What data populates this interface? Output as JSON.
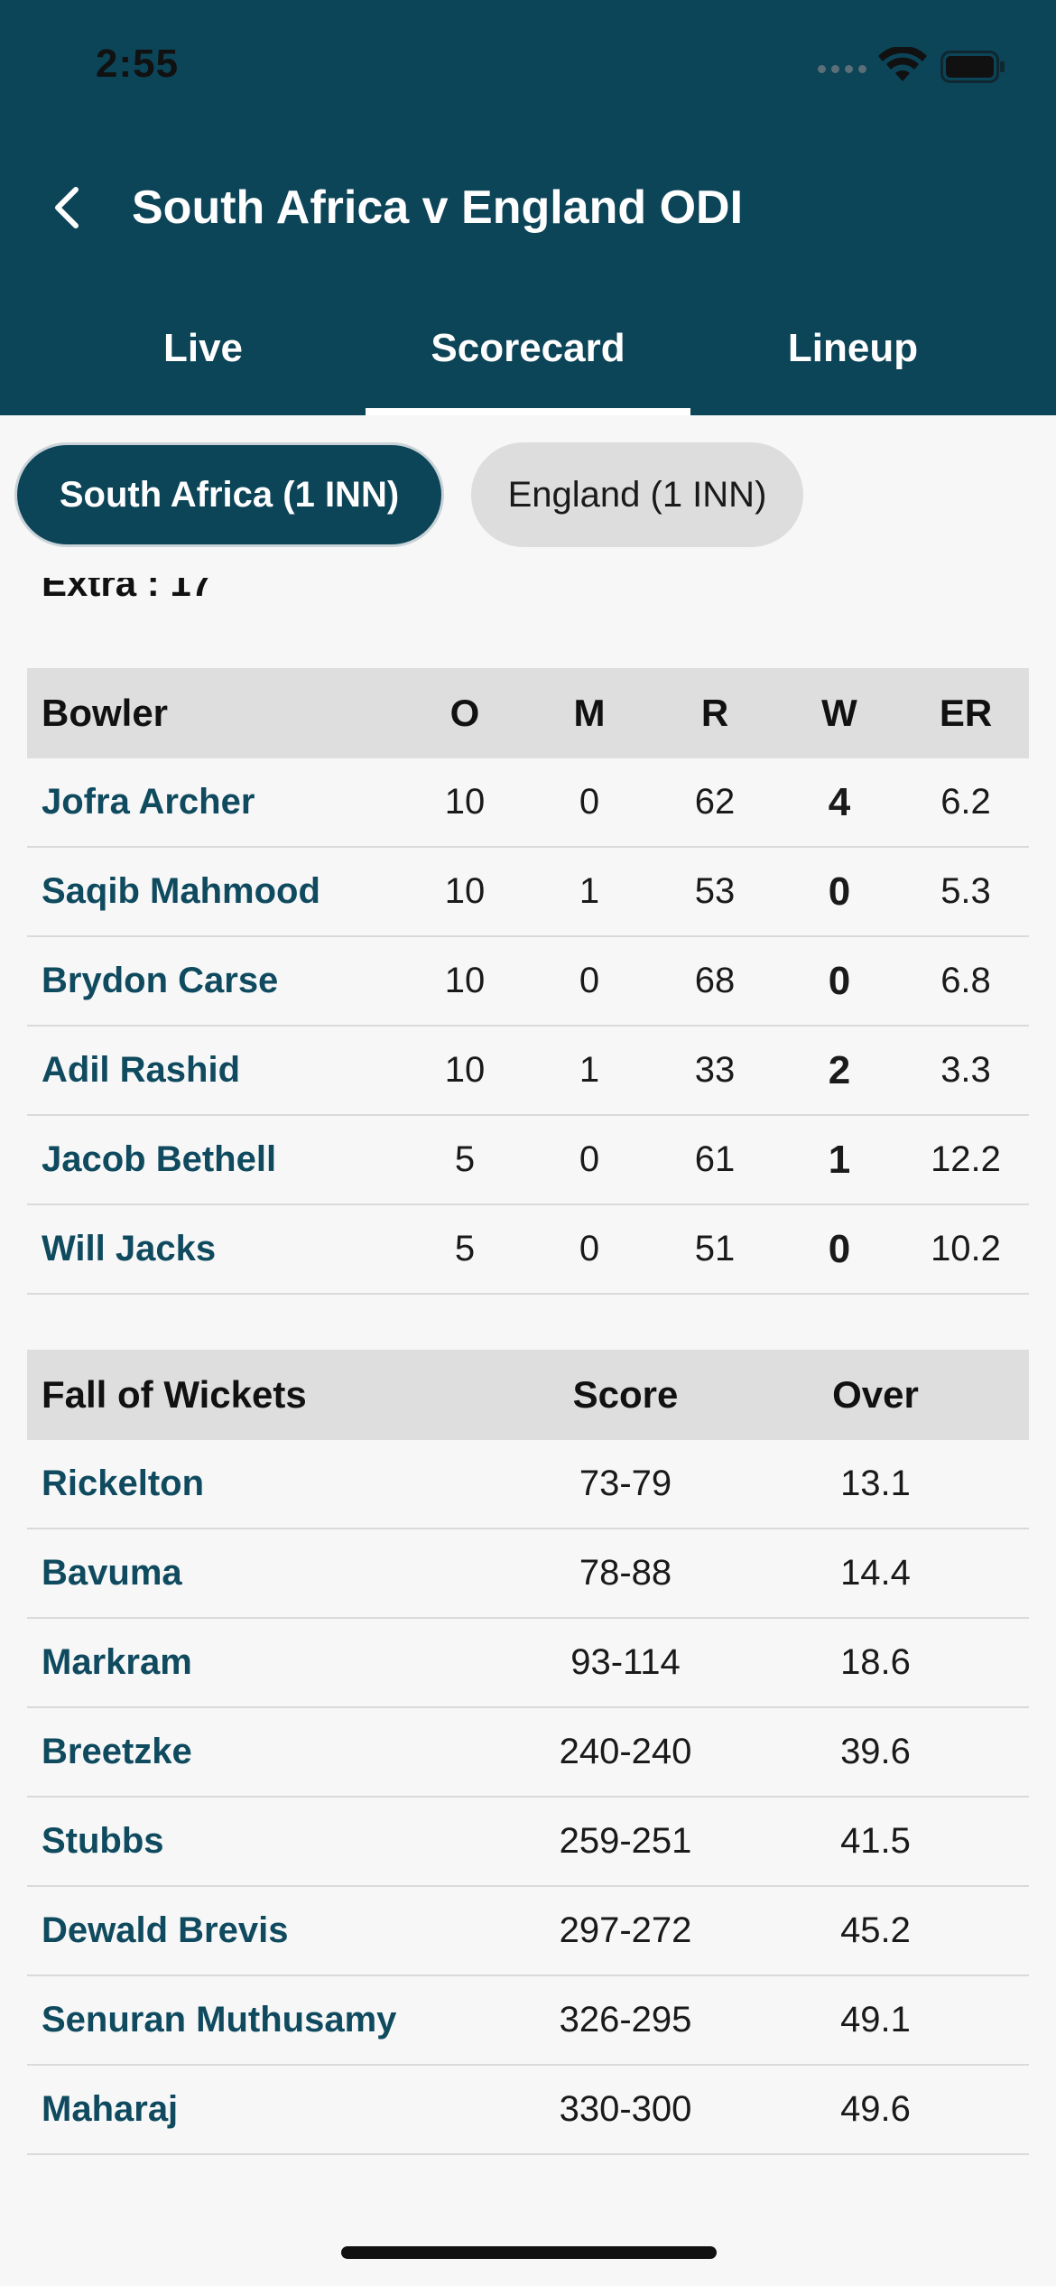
{
  "status_bar": {
    "time": "2:55"
  },
  "header": {
    "title": "South Africa v England ODI"
  },
  "tabs": [
    {
      "label": "Live"
    },
    {
      "label": "Scorecard"
    },
    {
      "label": "Lineup"
    }
  ],
  "active_tab": "Scorecard",
  "innings": [
    {
      "label": "South Africa (1 INN)",
      "active": true
    },
    {
      "label": "England (1 INN)",
      "active": false
    }
  ],
  "extras_text": "Extra : 17",
  "bowling": {
    "headers": {
      "bowler": "Bowler",
      "o": "O",
      "m": "M",
      "r": "R",
      "w": "W",
      "er": "ER"
    },
    "rows": [
      {
        "name": "Jofra Archer",
        "o": "10",
        "m": "0",
        "r": "62",
        "w": "4",
        "er": "6.2"
      },
      {
        "name": "Saqib Mahmood",
        "o": "10",
        "m": "1",
        "r": "53",
        "w": "0",
        "er": "5.3"
      },
      {
        "name": "Brydon Carse",
        "o": "10",
        "m": "0",
        "r": "68",
        "w": "0",
        "er": "6.8"
      },
      {
        "name": "Adil Rashid",
        "o": "10",
        "m": "1",
        "r": "33",
        "w": "2",
        "er": "3.3"
      },
      {
        "name": "Jacob Bethell",
        "o": "5",
        "m": "0",
        "r": "61",
        "w": "1",
        "er": "12.2"
      },
      {
        "name": "Will Jacks",
        "o": "5",
        "m": "0",
        "r": "51",
        "w": "0",
        "er": "10.2"
      }
    ]
  },
  "fall_of_wickets": {
    "headers": {
      "name": "Fall of Wickets",
      "score": "Score",
      "over": "Over"
    },
    "rows": [
      {
        "name": "Rickelton",
        "score": "73-79",
        "over": "13.1"
      },
      {
        "name": "Bavuma",
        "score": "78-88",
        "over": "14.4"
      },
      {
        "name": "Markram",
        "score": "93-114",
        "over": "18.6"
      },
      {
        "name": "Breetzke",
        "score": "240-240",
        "over": "39.6"
      },
      {
        "name": "Stubbs",
        "score": "259-251",
        "over": "41.5"
      },
      {
        "name": "Dewald Brevis",
        "score": "297-272",
        "over": "45.2"
      },
      {
        "name": "Senuran Muthusamy",
        "score": "326-295",
        "over": "49.1"
      },
      {
        "name": "Maharaj",
        "score": "330-300",
        "over": "49.6"
      }
    ]
  },
  "colors": {
    "header_bg": "#0c4458",
    "link": "#0f4a5f",
    "table_header_bg": "#dedede",
    "pill_inactive_bg": "#dddddd"
  }
}
